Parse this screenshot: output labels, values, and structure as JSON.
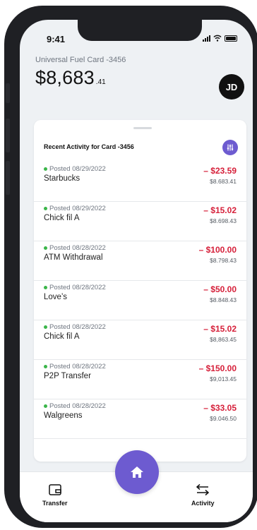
{
  "status_bar": {
    "time": "9:41"
  },
  "account": {
    "card_name": "Universal Fuel Card -3456",
    "balance_main": "$8,683",
    "balance_cents": ".41",
    "avatar_initials": "JD"
  },
  "activity": {
    "title": "Recent Activity for Card -3456",
    "transactions": [
      {
        "posted": "Posted 08/29/2022",
        "merchant": "Starbucks",
        "amount": "– $23.59",
        "balance": "$8.683.41"
      },
      {
        "posted": "Posted 08/29/2022",
        "merchant": "Chick fil A",
        "amount": "– $15.02",
        "balance": "$8.698.43"
      },
      {
        "posted": "Posted 08/28/2022",
        "merchant": "ATM Withdrawal",
        "amount": "– $100.00",
        "balance": "$8.798.43"
      },
      {
        "posted": "Posted 08/28/2022",
        "merchant": "Love’s",
        "amount": "– $50.00",
        "balance": "$8.848.43"
      },
      {
        "posted": "Posted 08/28/2022",
        "merchant": "Chick fil A",
        "amount": "– $15.02",
        "balance": "$8,863.45"
      },
      {
        "posted": "Posted 08/28/2022",
        "merchant": "P2P Transfer",
        "amount": "– $150.00",
        "balance": "$9,013.45"
      },
      {
        "posted": "Posted 08/28/2022",
        "merchant": "Walgreens",
        "amount": "– $33.05",
        "balance": "$9.046.50"
      }
    ]
  },
  "tabbar": {
    "transfer_label": "Transfer",
    "activity_label": "Activity",
    "icons": {
      "transfer": "wallet-icon",
      "home": "home-icon",
      "activity": "swap-arrows-icon"
    }
  },
  "colors": {
    "accent": "#6d5bd0",
    "debit": "#d6203a",
    "posted_dot": "#3bb54a"
  }
}
